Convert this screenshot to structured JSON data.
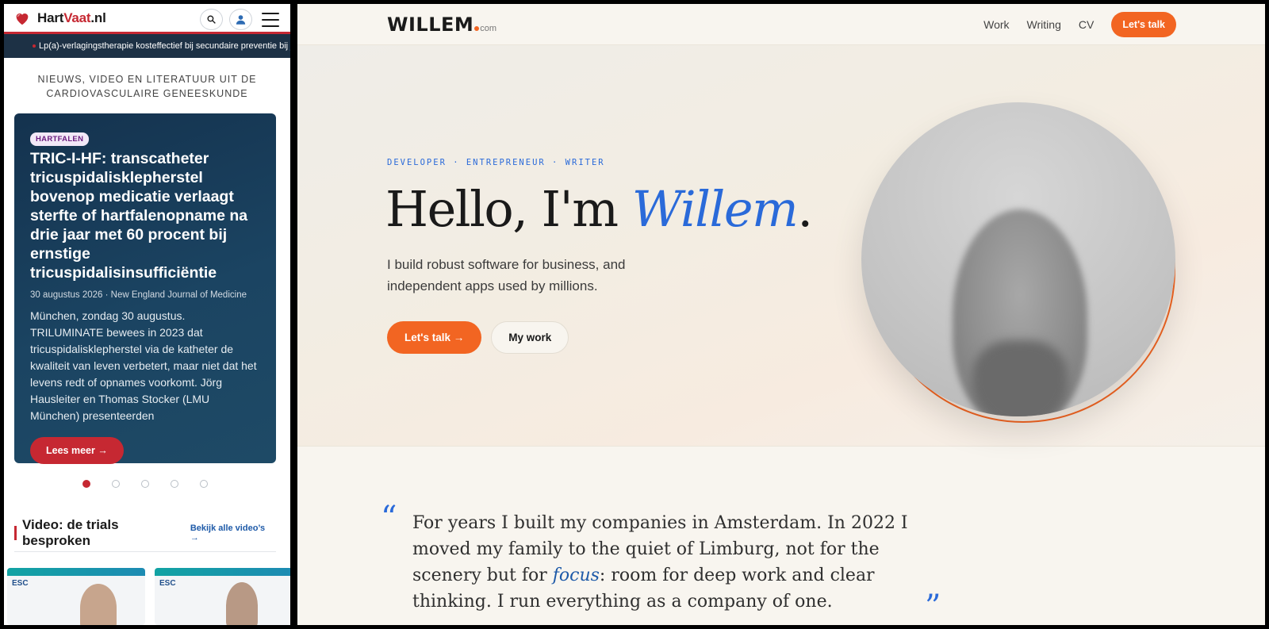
{
  "left_site": {
    "logo": {
      "part1": "Hart",
      "part2": "Vaat",
      "part3": ".nl"
    },
    "ticker": "Lp(a)-verlagingstherapie kosteffectief bij secundaire preventie bij j",
    "tagline_line1": "NIEUWS, VIDEO EN LITERATUUR UIT DE",
    "tagline_line2": "CARDIOVASCULAIRE GENEESKUNDE",
    "hero": {
      "badge": "HARTFALEN",
      "title": "TRIC-I-HF: transcatheter tricuspidalisklepherstel bovenop medicatie verlaagt sterfte of hartfalenopname na drie jaar met 60 procent bij ernstige tricuspidalisinsufficiëntie",
      "meta": "30 augustus 2026 · New England Journal of Medicine",
      "body": "München, zondag 30 augustus. TRILUMINATE bewees in 2023 dat tricuspidalisklepherstel via de katheter de kwaliteit van leven verbetert, maar niet dat het levens redt of opnames voorkomt. Jörg Hausleiter en Thomas Stocker (LMU München) presenteerden",
      "button": "Lees meer →"
    },
    "video": {
      "title": "Video: de trials besproken",
      "link": "Bekijk alle video’s →",
      "thumb1_label": "ESC",
      "thumb2_label": "ESC"
    },
    "colors": {
      "brand_red": "#c62832",
      "navy": "#1d3145"
    }
  },
  "right_site": {
    "brand": {
      "name": "WILLEM",
      "suffix": "com"
    },
    "nav": {
      "work": "Work",
      "writing": "Writing",
      "cv": "CV",
      "talk": "Let's talk"
    },
    "roles": "DEVELOPER · ENTREPRENEUR · WRITER",
    "hello_prefix": "Hello, I'm ",
    "hello_name": "Willem",
    "hello_suffix": ".",
    "intro": "I build robust software for business, and independent apps used by millions.",
    "cta_primary": "Let's talk  →",
    "cta_secondary": "My work",
    "quote_part1": "For years I built my companies in Amsterdam. In 2022 I moved my family to the quiet of Limburg, not for the scenery but for ",
    "quote_em": "focus",
    "quote_part2": ": room for deep work and clear thinking. I run everything as a company of one.",
    "quote_open": "“",
    "quote_close": "”",
    "colors": {
      "accent_orange": "#f26522",
      "accent_blue": "#2a6ad9",
      "background": "#f8f5ef"
    }
  }
}
